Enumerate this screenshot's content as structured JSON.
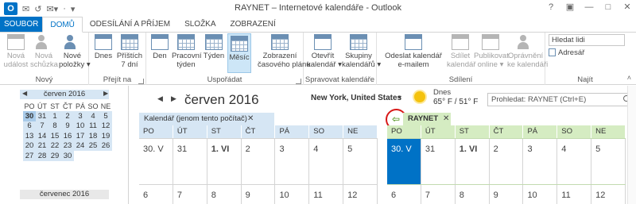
{
  "window": {
    "app_icon": "O",
    "title": "RAYNET – Internetové kalendáře - Outlook",
    "qat": [
      "✉",
      "↺",
      "✉▾",
      "·",
      "▾"
    ],
    "controls": [
      "?",
      "▣",
      "—",
      "□",
      "✕"
    ]
  },
  "tabs": [
    {
      "label": "SOUBOR"
    },
    {
      "label": "DOMŮ"
    },
    {
      "label": "ODESÍLÁNÍ A PŘÍJEM"
    },
    {
      "label": "SLOŽKA"
    },
    {
      "label": "ZOBRAZENÍ"
    }
  ],
  "ribbon": {
    "groups": {
      "novy": {
        "label": "Nový",
        "new_event_l1": "Nová",
        "new_event_l2": "událost",
        "new_meeting_l1": "Nová",
        "new_meeting_l2": "schůzka",
        "new_items_l1": "Nové",
        "new_items_l2": "položky ▾"
      },
      "prejit": {
        "label": "Přejít na",
        "today": "Dnes",
        "next7_l1": "Příštích",
        "next7_l2": "7 dní"
      },
      "usporadat": {
        "label": "Uspořádat",
        "day": "Den",
        "workweek_l1": "Pracovní",
        "workweek_l2": "týden",
        "week": "Týden",
        "month": "Měsíc",
        "schedule_l1": "Zobrazení",
        "schedule_l2": "časového plánu"
      },
      "spravovat": {
        "label": "Spravovat kalendáře",
        "open_l1": "Otevřít",
        "open_l2": "kalendář ▾",
        "groups_l1": "Skupiny",
        "groups_l2": "kalendářů ▾"
      },
      "sdileni": {
        "label": "Sdílení",
        "email_l1": "Odeslat kalendář",
        "email_l2": "e-mailem",
        "share_l1": "Sdílet",
        "share_l2": "kalendář",
        "publish_l1": "Publikovat",
        "publish_l2": "online ▾",
        "perm_l1": "Oprávnění",
        "perm_l2": "ke kalendáři"
      },
      "najit": {
        "label": "Najít",
        "search_people": "Hledat lidi",
        "address_book": "Adresář"
      }
    },
    "collapse": "˄"
  },
  "minical": {
    "title": "červen 2016",
    "prev": "◀",
    "next": "▶",
    "dow": [
      "PO",
      "ÚT",
      "ST",
      "ČT",
      "PÁ",
      "SO",
      "NE"
    ],
    "weeks": [
      [
        "30",
        "31",
        "1",
        "2",
        "3",
        "4",
        "5"
      ],
      [
        "6",
        "7",
        "8",
        "9",
        "10",
        "11",
        "12"
      ],
      [
        "13",
        "14",
        "15",
        "16",
        "17",
        "18",
        "19"
      ],
      [
        "20",
        "21",
        "22",
        "23",
        "24",
        "25",
        "26"
      ],
      [
        "27",
        "28",
        "29",
        "30",
        "",
        "",
        ""
      ]
    ],
    "next_month": "červenec 2016"
  },
  "calendar": {
    "nav_prev": "◀",
    "nav_next": "▶",
    "month_title": "červen 2016",
    "location": "New York, United States",
    "location_caret": "▾",
    "weather_day": "Dnes",
    "weather_temp": "65° F / 51° F",
    "search_placeholder": "Prohledat: RAYNET (Ctrl+E)"
  },
  "pane_local": {
    "tab_label": "Kalendář (jenom tento počítač)",
    "close": "✕",
    "dow": [
      "PO",
      "ÚT",
      "ST",
      "ČT",
      "PÁ",
      "SO",
      "NE"
    ],
    "week1": [
      "30. V",
      "31",
      "1. VI",
      "2",
      "3",
      "4",
      "5"
    ],
    "week2": [
      "6",
      "7",
      "8",
      "9",
      "10",
      "11",
      "12"
    ]
  },
  "pane_raynet": {
    "tab_label": "RAYNET",
    "close": "✕",
    "overlay_arrow": "⇦",
    "dow": [
      "PO",
      "ÚT",
      "ST",
      "ČT",
      "PÁ",
      "SO",
      "NE"
    ],
    "week1": [
      "30. V",
      "31",
      "1. VI",
      "2",
      "3",
      "4",
      "5"
    ],
    "week2": [
      "6",
      "7",
      "8",
      "9",
      "10",
      "11",
      "12"
    ]
  },
  "colors": {
    "accent": "#0072c6",
    "local_calendar": "#d6e6f4",
    "raynet_calendar": "#d5ecc2",
    "highlight_circle": "#d81818"
  }
}
